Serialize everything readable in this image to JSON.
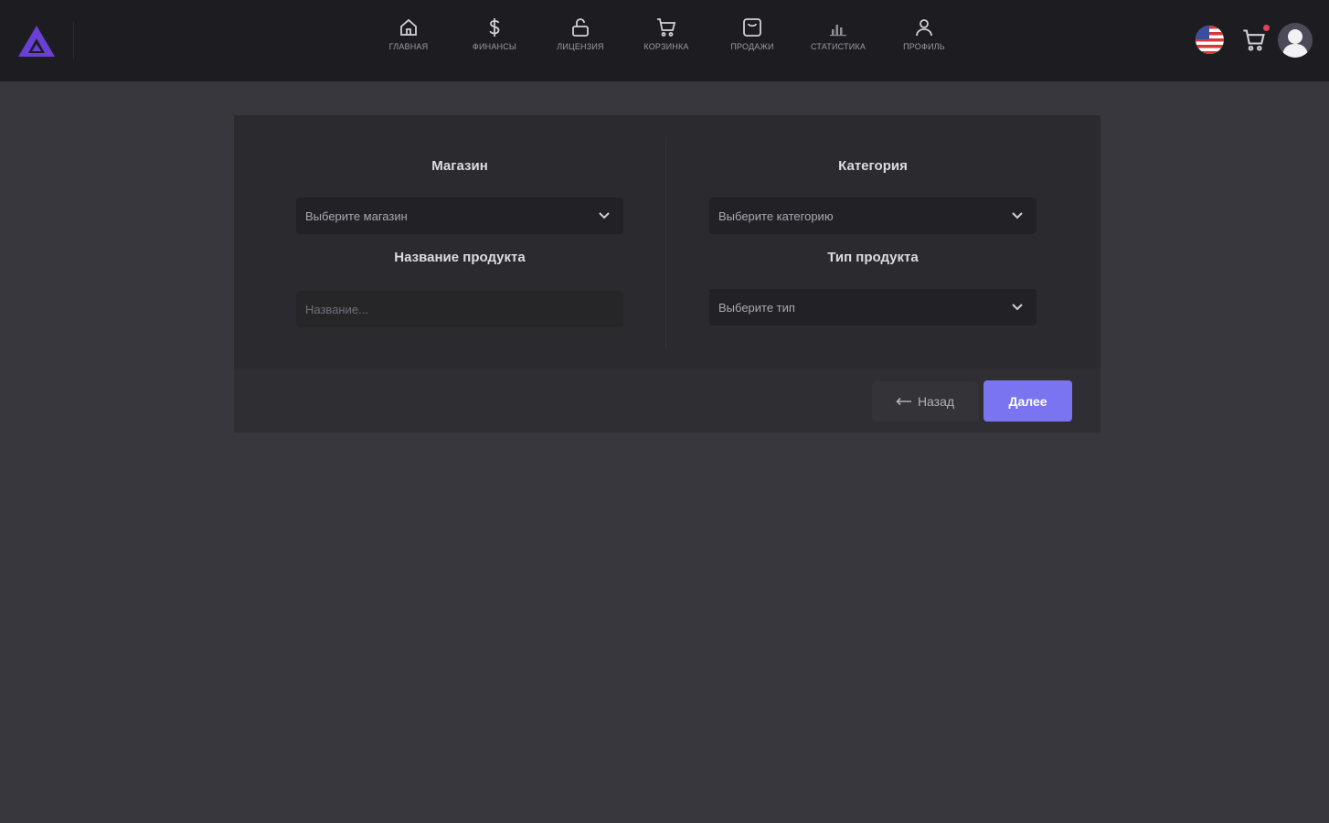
{
  "colors": {
    "accent": "#7b74f0",
    "logo": "#6a3fd6",
    "topbar_bg": "#1d1d21",
    "page_bg": "#38373d",
    "card_bg": "#2a2a2f",
    "notification_dot": "#e0445a"
  },
  "nav": {
    "items": [
      {
        "label": "Главная",
        "icon": "home-icon"
      },
      {
        "label": "Финансы",
        "icon": "dollar-icon"
      },
      {
        "label": "Лицензия",
        "icon": "lock-icon"
      },
      {
        "label": "Корзинка",
        "icon": "cart-icon"
      },
      {
        "label": "Продажи",
        "icon": "sales-icon"
      },
      {
        "label": "Статистика",
        "icon": "chart-icon"
      },
      {
        "label": "Профиль",
        "icon": "user-icon"
      }
    ]
  },
  "header_right": {
    "language_icon": "us-flag-icon",
    "cart_icon": "cart-icon",
    "avatar_icon": "avatar-icon"
  },
  "form": {
    "store": {
      "label": "Магазин",
      "placeholder": "Выберите магазин"
    },
    "category": {
      "label": "Категория",
      "placeholder": "Выберите категорию"
    },
    "product_name": {
      "label": "Название продукта",
      "placeholder": "Название..."
    },
    "product_type": {
      "label": "Тип продукта",
      "placeholder": "Выберите тип"
    }
  },
  "footer": {
    "back_label": "Назад",
    "next_label": "Далее"
  }
}
